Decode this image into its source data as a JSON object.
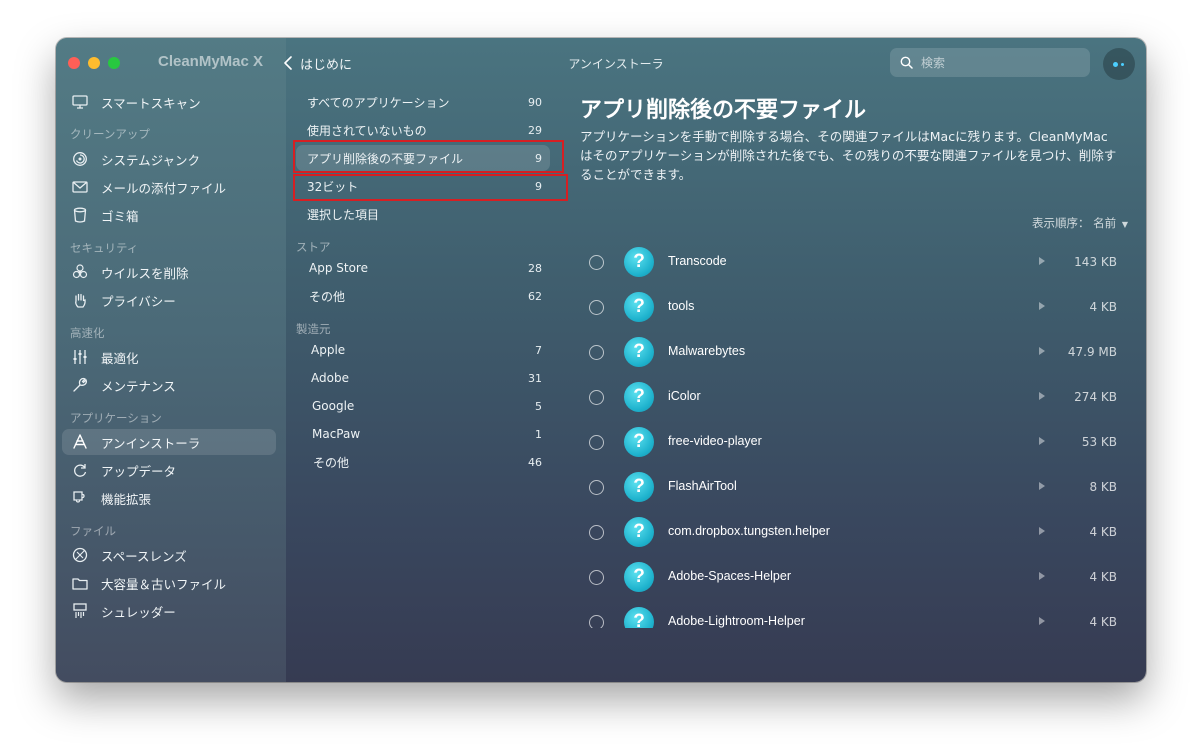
{
  "app": {
    "title": "CleanMyMac X",
    "back_label": "はじめに",
    "window_title": "アンインストーラ",
    "search_placeholder": "検索",
    "colors": {
      "accent": "#4ccfff",
      "highlight": "#d61f23",
      "app_icon": "#22b8d0"
    }
  },
  "sidebar": {
    "top": {
      "label": "スマートスキャン",
      "icon": "monitor-icon"
    },
    "sections": [
      {
        "title": "クリーンアップ",
        "items": [
          {
            "label": "システムジャンク",
            "icon": "swirl-icon"
          },
          {
            "label": "メールの添付ファイル",
            "icon": "envelope-icon"
          },
          {
            "label": "ゴミ箱",
            "icon": "trash-icon"
          }
        ]
      },
      {
        "title": "セキュリティ",
        "items": [
          {
            "label": "ウイルスを削除",
            "icon": "biohazard-icon"
          },
          {
            "label": "プライバシー",
            "icon": "hand-icon"
          }
        ]
      },
      {
        "title": "高速化",
        "items": [
          {
            "label": "最適化",
            "icon": "sliders-icon"
          },
          {
            "label": "メンテナンス",
            "icon": "wrench-icon"
          }
        ]
      },
      {
        "title": "アプリケーション",
        "items": [
          {
            "label": "アンインストーラ",
            "icon": "uninstaller-icon",
            "active": true
          },
          {
            "label": "アップデータ",
            "icon": "update-icon"
          },
          {
            "label": "機能拡張",
            "icon": "extension-icon"
          }
        ]
      },
      {
        "title": "ファイル",
        "items": [
          {
            "label": "スペースレンズ",
            "icon": "lens-icon"
          },
          {
            "label": "大容量＆古いファイル",
            "icon": "folder-icon"
          },
          {
            "label": "シュレッダー",
            "icon": "shredder-icon"
          }
        ]
      }
    ]
  },
  "filters": {
    "top_items": [
      {
        "label": "すべてのアプリケーション",
        "count": "90"
      },
      {
        "label": "使用されていないもの",
        "count": "29"
      },
      {
        "label": "アプリ削除後の不要ファイル",
        "count": "9",
        "selected": true
      },
      {
        "label": "32ビット",
        "count": "9"
      },
      {
        "label": "選択した項目",
        "count": ""
      }
    ],
    "store_title": "ストア",
    "store_items": [
      {
        "label": "App Store",
        "count": "28"
      },
      {
        "label": "その他",
        "count": "62"
      }
    ],
    "vendor_title": "製造元",
    "vendor_items": [
      {
        "label": "Apple",
        "count": "7"
      },
      {
        "label": "Adobe",
        "count": "31"
      },
      {
        "label": "Google",
        "count": "5"
      },
      {
        "label": "MacPaw",
        "count": "1"
      },
      {
        "label": "その他",
        "count": "46"
      }
    ]
  },
  "main": {
    "title": "アプリ削除後の不要ファイル",
    "description": "アプリケーションを手動で削除する場合、その関連ファイルはMacに残ります。CleanMyMacはそのアプリケーションが削除された後でも、その残りの不要な関連ファイルを見つけ、削除することができます。",
    "sort_label": "表示順序：",
    "sort_value": "名前",
    "apps": [
      {
        "name": "Transcode",
        "size": "143 KB"
      },
      {
        "name": "tools",
        "size": "4 KB"
      },
      {
        "name": "Malwarebytes",
        "size": "47.9 MB"
      },
      {
        "name": "iColor",
        "size": "274 KB"
      },
      {
        "name": "free-video-player",
        "size": "53 KB"
      },
      {
        "name": "FlashAirTool",
        "size": "8 KB"
      },
      {
        "name": "com.dropbox.tungsten.helper",
        "size": "4 KB"
      },
      {
        "name": "Adobe-Spaces-Helper",
        "size": "4 KB"
      },
      {
        "name": "Adobe-Lightroom-Helper",
        "size": "4 KB"
      }
    ]
  }
}
